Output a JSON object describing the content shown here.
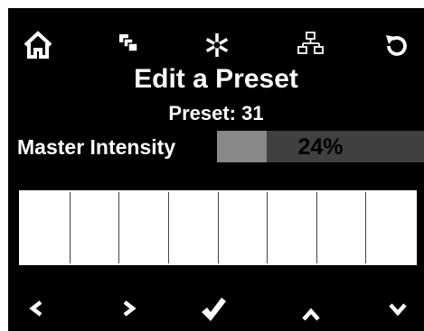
{
  "screen": {
    "title": "Edit a Preset",
    "preset_label": "Preset: 31",
    "accent_color": "#ffffff",
    "background_color": "#000000"
  },
  "top_icons": [
    "home-icon",
    "copy-icon",
    "asterisk-icon",
    "network-icon",
    "undo-icon"
  ],
  "master_intensity": {
    "label": "Master Intensity",
    "value_text": "24%",
    "level": 0.24
  },
  "slots": {
    "count": 8
  },
  "bottom_icons": [
    "chevron-left-icon",
    "chevron-right-icon",
    "checkmark-icon",
    "chevron-up-icon",
    "chevron-down-icon"
  ]
}
